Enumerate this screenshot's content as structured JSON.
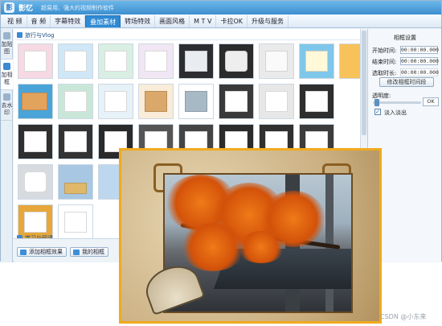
{
  "app": {
    "name": "影忆",
    "tagline": "超易用、强大的视频制作软件"
  },
  "tabs": [
    {
      "label": "视 频",
      "active": false
    },
    {
      "label": "音 频",
      "active": false
    },
    {
      "label": "字幕特效",
      "active": false
    },
    {
      "label": "叠加素材",
      "active": true
    },
    {
      "label": "转场特效",
      "active": false
    },
    {
      "label": "画面风格",
      "active": false
    },
    {
      "label": "M T V",
      "active": false
    },
    {
      "label": "卡拉OK",
      "active": false
    },
    {
      "label": "升级与服务",
      "active": false
    }
  ],
  "side_tabs": [
    {
      "label": "加贴图",
      "active": false
    },
    {
      "label": "加相框",
      "active": true
    },
    {
      "label": "去水印",
      "active": false
    }
  ],
  "sections": {
    "first": "旅行与Vlog",
    "second": "学习与网课"
  },
  "bottom_buttons": {
    "add_effect": "添加相框效果",
    "my_frames": "我的相框"
  },
  "settings": {
    "title": "相框设置",
    "start_label": "开始时间:",
    "start_value": "00:00:00.000",
    "end_label": "结束时间:",
    "end_value": "00:00:00.000",
    "duration_label": "选取时长:",
    "duration_value": "00:00:00.000",
    "modify_button": "修改相框时间段",
    "opacity_label": "透明度:",
    "ok_label": "OK",
    "fade_label": "淡入淡出",
    "fade_checked": true,
    "opacity_fraction": 0.0
  },
  "watermark": "CSDN @小东来",
  "colors": {
    "accent": "#2d8ad5",
    "preview_border": "#f0aa1e"
  }
}
